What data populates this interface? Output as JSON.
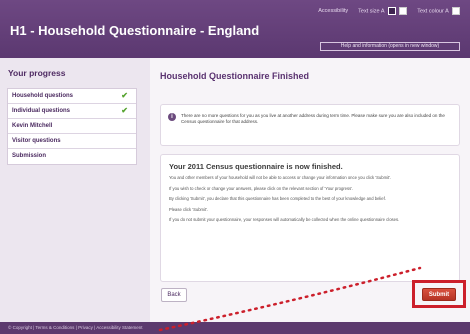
{
  "header": {
    "title": "H1 - Household Questionnaire - England",
    "accessibility_link": "Accessibility",
    "text_size_label": "Text size",
    "text_size_small": "A",
    "text_size_large": "A",
    "text_colour_label": "Text colour",
    "text_colour_option": "A",
    "help_link": "Help and information (opens in new window)"
  },
  "progress": {
    "title": "Your progress",
    "items": [
      {
        "label": "Household questions",
        "complete": true
      },
      {
        "label": "Individual questions",
        "complete": true
      },
      {
        "label": "Kevin Mitchell",
        "complete": false
      },
      {
        "label": "Visitor questions",
        "complete": false
      },
      {
        "label": "Submission",
        "complete": false
      }
    ],
    "check_glyph": "✔"
  },
  "main": {
    "heading": "Household Questionnaire Finished",
    "info_text": "There are no more questions for you as you live at another address during term time. Please make sure you are also included on the Census questionnaire for that address.",
    "finished_heading": "Your 2011 Census questionnaire is now finished.",
    "paragraphs": [
      "You and other members of your household will not be able to access or change your information once you click 'Submit'.",
      "If you wish to check or change your answers, please click on the relevant section of 'Your progress'.",
      "By clicking 'Submit', you declare that this questionnaire has been completed to the best of your knowledge and belief.",
      "Please click 'Submit'.",
      "If you do not submit your questionnaire, your responses will automatically be collected when the online questionnaire closes."
    ],
    "back_label": "Back",
    "submit_label": "Submit"
  },
  "footer": {
    "text": "© Copyright  |  Terms & Conditions  |  Privacy  |  Accessibility Statement"
  },
  "colors": {
    "brand_purple": "#5c3a6e",
    "submit_red": "#c0392b",
    "highlight_red": "#cc1f2b",
    "check_green": "#55a32e"
  }
}
